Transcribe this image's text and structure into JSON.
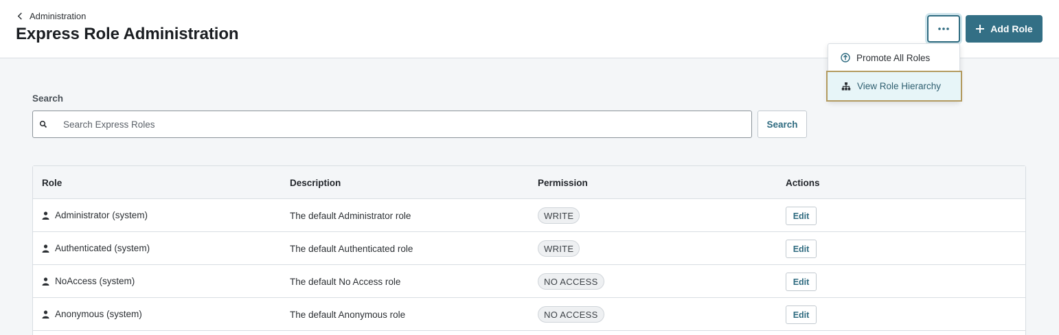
{
  "header": {
    "breadcrumb": "Administration",
    "title": "Express Role Administration",
    "more_button_icon": "ellipsis-icon",
    "add_button_label": "Add Role"
  },
  "dropdown": {
    "items": [
      {
        "label": "Promote All Roles",
        "icon": "arrow-up-circle-icon"
      },
      {
        "label": "View Role Hierarchy",
        "icon": "hierarchy-icon"
      }
    ]
  },
  "search": {
    "label": "Search",
    "placeholder": "Search Express Roles",
    "value": "",
    "button_label": "Search"
  },
  "table": {
    "columns": [
      "Role",
      "Description",
      "Permission",
      "Actions"
    ],
    "rows": [
      {
        "role": "Administrator (system)",
        "description": "The default Administrator role",
        "permission": "WRITE",
        "action": "Edit"
      },
      {
        "role": "Authenticated (system)",
        "description": "The default Authenticated role",
        "permission": "WRITE",
        "action": "Edit"
      },
      {
        "role": "NoAccess (system)",
        "description": "The default No Access role",
        "permission": "NO ACCESS",
        "action": "Edit"
      },
      {
        "role": "Anonymous (system)",
        "description": "The default Anonymous role",
        "permission": "NO ACCESS",
        "action": "Edit"
      }
    ]
  },
  "colors": {
    "primary": "#336f85",
    "highlight_bg": "#e7f5f8",
    "highlight_border": "#b39a5f"
  }
}
